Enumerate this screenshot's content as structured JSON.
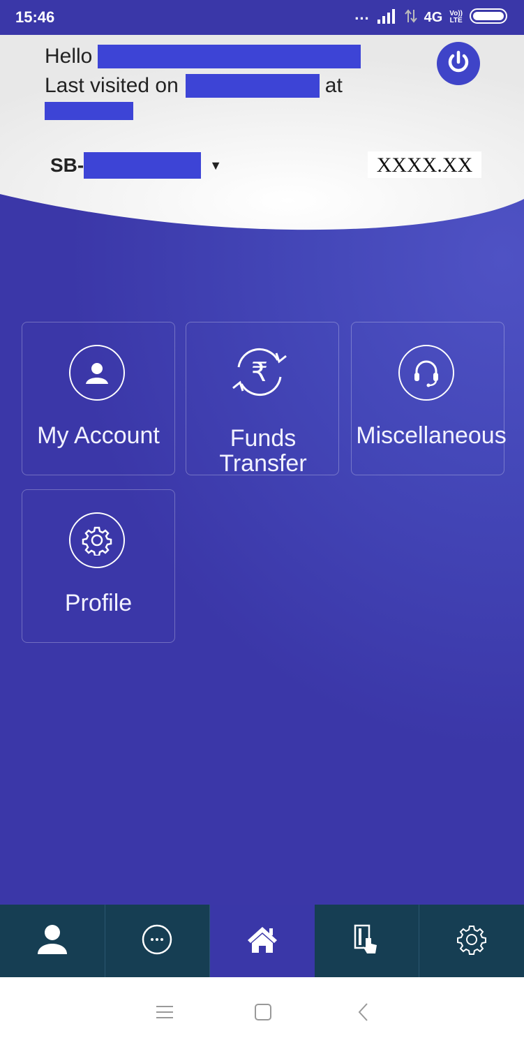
{
  "status_bar": {
    "time": "15:46",
    "dots": "...",
    "network": "4G",
    "volte_top": "Vo))",
    "volte_bottom": "LTE"
  },
  "header": {
    "hello": "Hello",
    "last_visited": "Last visited on",
    "at": "at",
    "account_prefix": "SB-",
    "balance": "XXXX.XX"
  },
  "tiles": [
    {
      "label": "My Account",
      "icon": "user-circle-icon"
    },
    {
      "label": "Funds Transfer",
      "icon": "rupee-exchange-icon"
    },
    {
      "label": "Miscellaneous",
      "icon": "headset-icon"
    },
    {
      "label": "Profile",
      "icon": "gear-icon"
    }
  ],
  "bottom_nav": [
    {
      "icon": "user-icon"
    },
    {
      "icon": "more-icon"
    },
    {
      "icon": "home-icon",
      "active": true
    },
    {
      "icon": "card-tap-icon"
    },
    {
      "icon": "settings-icon"
    }
  ],
  "colors": {
    "primary": "#3a37a8",
    "nav_dark": "#163e53",
    "redaction": "#3d44d6"
  }
}
